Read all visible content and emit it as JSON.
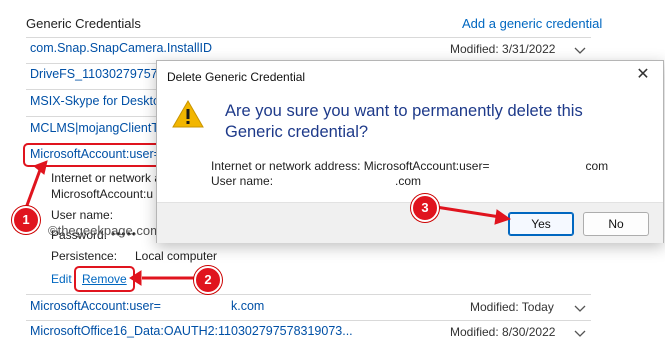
{
  "header": {
    "title": "Generic Credentials",
    "add_link": "Add a generic credential"
  },
  "rows": [
    {
      "name": "com.Snap.SnapCamera.InstallID",
      "modified": "Modified:  3/31/2022"
    },
    {
      "name": "DriveFS_11030279757831"
    },
    {
      "name": "MSIX-Skype for Desktop/"
    },
    {
      "name": "MCLMS|mojangClientTo"
    },
    {
      "name": "MicrosoftAccount:user="
    }
  ],
  "expanded": {
    "address_label": "Internet or network a",
    "address_value": "MicrosoftAccount:u",
    "username_label": "User name:",
    "password_label": "Password:",
    "password_value": "•••••",
    "persistence_label": "Persistence:",
    "persistence_value": "Local computer",
    "edit": "Edit",
    "remove": "Remove"
  },
  "bottom_rows": [
    {
      "name": "MicrosoftAccount:user=",
      "name_suffix": "k.com",
      "modified": "Modified:  Today"
    },
    {
      "name": "MicrosoftOffice16_Data:OAUTH2:110302797578319073...",
      "modified": "Modified:  8/30/2022"
    }
  ],
  "dialog": {
    "title": "Delete Generic Credential",
    "close": "✕",
    "question": "Are you sure you want to permanently delete this Generic credential?",
    "address_line": "Internet or network address: MicrosoftAccount:user=",
    "address_suffix": "com",
    "username_line": "User name:",
    "username_suffix": ".com",
    "yes": "Yes",
    "no": "No"
  },
  "watermark": "©thegeekpage.com",
  "badges": [
    "1",
    "2",
    "3"
  ],
  "colors": {
    "link": "#0067c0",
    "annotation": "#e0141e",
    "warning": "#f2b600"
  }
}
